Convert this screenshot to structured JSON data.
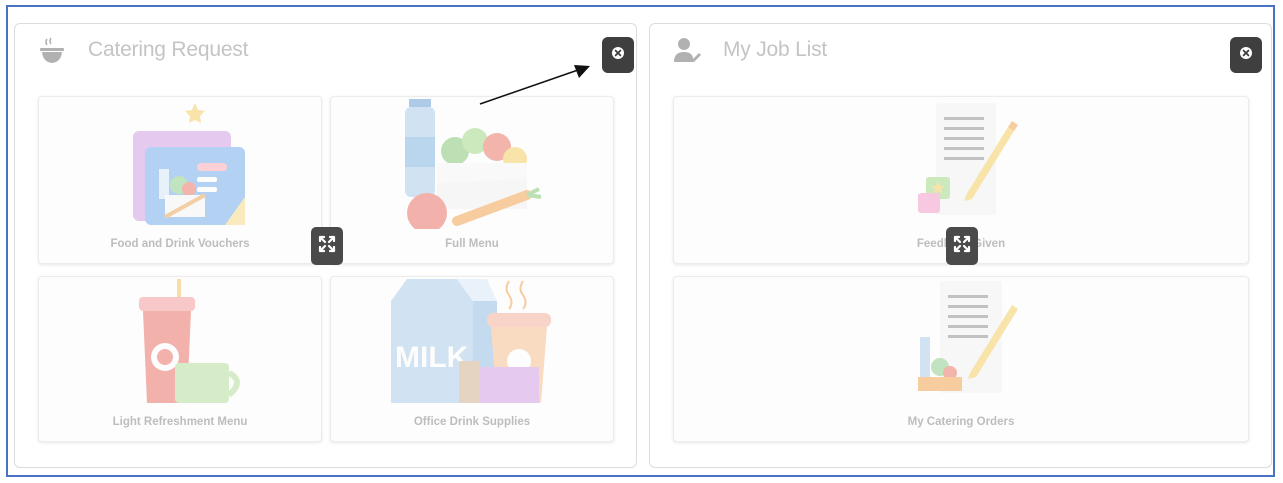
{
  "colors": {
    "frame_border": "#4a72c4",
    "button_dark": "#3f3f3f",
    "title_text": "#c4c4c4",
    "tile_label": "#bdbdbd"
  },
  "catering_panel": {
    "title": "Catering Request",
    "header_icon": "food-bowl-icon",
    "close_icon": "close-icon",
    "expand_icon": "expand-icon",
    "tiles": [
      {
        "label": "Food and Drink Vouchers",
        "icon": "vouchers-illustration"
      },
      {
        "label": "Full Menu",
        "icon": "full-menu-illustration"
      },
      {
        "label": "Light Refreshment Menu",
        "icon": "refreshment-illustration"
      },
      {
        "label": "Office Drink Supplies",
        "icon": "drink-supplies-illustration",
        "milk_text": "MILK"
      }
    ]
  },
  "job_panel": {
    "title": "My Job List",
    "header_icon": "user-edit-icon",
    "close_icon": "close-icon",
    "expand_icon": "expand-icon",
    "tiles": [
      {
        "label": "Feedback Given",
        "icon": "feedback-illustration"
      },
      {
        "label": "My Catering Orders",
        "icon": "catering-orders-illustration"
      }
    ]
  },
  "annotation": {
    "icon": "pointer-arrow"
  }
}
